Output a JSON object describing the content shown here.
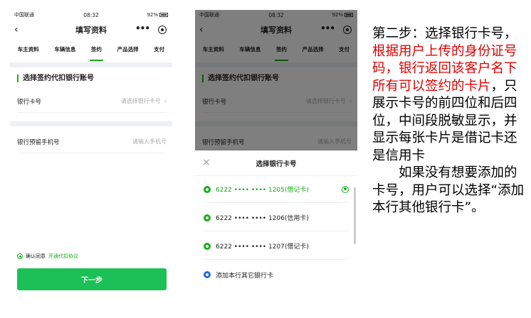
{
  "status": {
    "carrier": "中国联通",
    "time": "08:32",
    "battery": "92%"
  },
  "screen1": {
    "nav_title": "填写资料",
    "nav_more": "•••",
    "tabs": [
      "车主资料",
      "车辆信息",
      "签约",
      "产品选择",
      "支付"
    ],
    "active_tab": 2,
    "section_title": "选择签约代扣银行账号",
    "bank_card_label": "银行卡号",
    "bank_card_placeholder": "请选择银行卡号",
    "phone_label": "银行预留手机号",
    "phone_placeholder": "请输入手机号",
    "agree_text": "确认同意",
    "agree_link": "开通代扣协议",
    "next_button": "下一步"
  },
  "screen2": {
    "sheet_title": "选择银行卡号",
    "cards": [
      {
        "number": "6222 •••• •••• 1205(借记卡)",
        "selected": true
      },
      {
        "number": "6222 •••• •••• 1206(信用卡)",
        "selected": false
      },
      {
        "number": "6222 •••• •••• 1207(借记卡)",
        "selected": false
      }
    ],
    "add_card": "添加本行其它银行卡"
  },
  "description": {
    "part1": "第二步：选择银行卡号，",
    "part2_red": "根据用户上传的身份证号码，银行返回该客户名下所有可以签约的卡片",
    "part3": "，只展示卡号的前四位和后四位，中间段脱敏显示，并显示每张卡片是借记卡还是信用卡",
    "part4": "　　如果没有想要添加的卡号，用户可以选择“添加本行其他银行卡”。"
  },
  "colors": {
    "accent": "#1aad19",
    "button": "#1bc156",
    "highlight": "#e00000"
  }
}
